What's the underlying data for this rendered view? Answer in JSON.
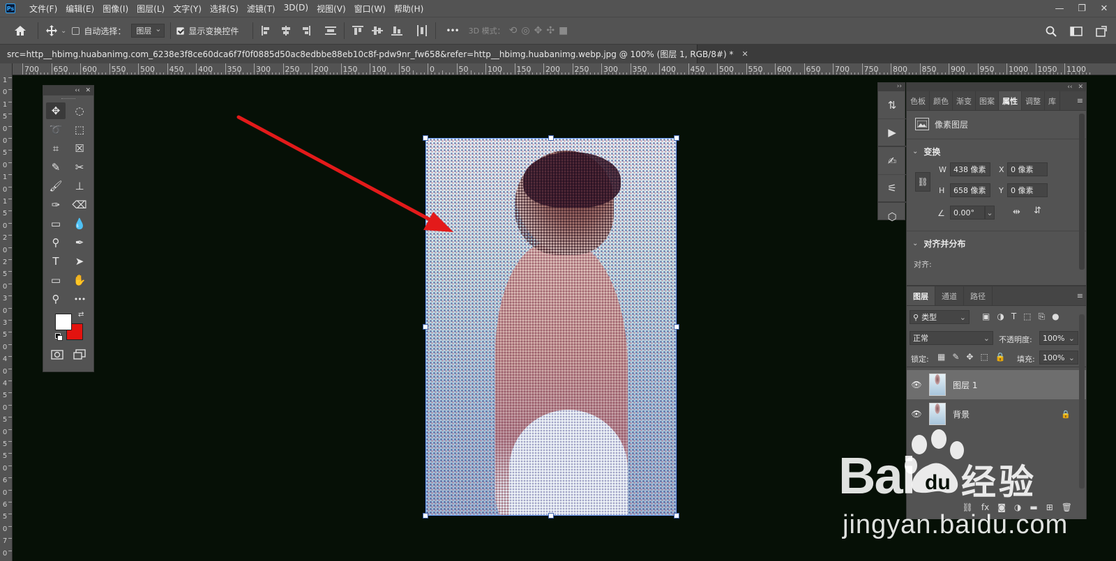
{
  "app": {
    "logo": "Ps"
  },
  "menu": [
    "文件(F)",
    "编辑(E)",
    "图像(I)",
    "图层(L)",
    "文字(Y)",
    "选择(S)",
    "滤镜(T)",
    "3D(D)",
    "视图(V)",
    "窗口(W)",
    "帮助(H)"
  ],
  "window_controls": {
    "minimize": "—",
    "restore": "❐",
    "close": "✕"
  },
  "options_bar": {
    "home_icon": "home-icon",
    "auto_select_label": "自动选择：",
    "auto_select_checked": false,
    "auto_select_target": "图层",
    "show_transform_label": "显示变换控件",
    "show_transform_checked": true,
    "more": "•••",
    "mode3d_label": "3D 模式："
  },
  "document": {
    "tab_title": "src=http__hbimg.huabanimg.com_6238e3f8ce60dca6f7f0f0885d50ac8edbbe88eb10c8f-pdw9nr_fw658&refer=http__hbimg.huabanimg.webp.jpg @ 100% (图层 1, RGB/8#) *",
    "close": "✕"
  },
  "ruler_h": [
    "700",
    "650",
    "600",
    "550",
    "500",
    "450",
    "400",
    "350",
    "300",
    "250",
    "200",
    "150",
    "100",
    "50",
    "0",
    "50",
    "100",
    "150",
    "200",
    "250",
    "300",
    "350",
    "400",
    "450",
    "500",
    "550",
    "600",
    "650",
    "700",
    "750",
    "800",
    "850",
    "900",
    "950",
    "1000",
    "1050",
    "1100"
  ],
  "ruler_v": [
    "1",
    "0",
    "1",
    "5",
    "0",
    "0",
    "5",
    "0",
    "1",
    "0",
    "1",
    "5",
    "0",
    "2",
    "0",
    "2",
    "5",
    "0",
    "3",
    "0",
    "3",
    "5",
    "0",
    "4",
    "0",
    "4",
    "5",
    "0",
    "5",
    "0",
    "5",
    "5",
    "0",
    "6",
    "0",
    "6",
    "5",
    "0",
    "7",
    "0"
  ],
  "tools_panel": {
    "collapse": "‹‹",
    "close": "✕",
    "tools": [
      {
        "name": "move-tool",
        "glyph": "✥",
        "active": true
      },
      {
        "name": "marquee-tool",
        "glyph": "◌"
      },
      {
        "name": "lasso-tool",
        "glyph": "➰"
      },
      {
        "name": "object-select-tool",
        "glyph": "⬚"
      },
      {
        "name": "crop-tool",
        "glyph": "⌗"
      },
      {
        "name": "frame-tool",
        "glyph": "☒"
      },
      {
        "name": "eyedropper-tool",
        "glyph": "✎"
      },
      {
        "name": "healing-tool",
        "glyph": "✂"
      },
      {
        "name": "brush-tool",
        "glyph": "🖌"
      },
      {
        "name": "stamp-tool",
        "glyph": "⊥"
      },
      {
        "name": "history-brush-tool",
        "glyph": "✑"
      },
      {
        "name": "eraser-tool",
        "glyph": "⌫"
      },
      {
        "name": "gradient-tool",
        "glyph": "▭"
      },
      {
        "name": "blur-tool",
        "glyph": "💧"
      },
      {
        "name": "dodge-tool",
        "glyph": "⚲"
      },
      {
        "name": "pen-tool",
        "glyph": "✒"
      },
      {
        "name": "type-tool",
        "glyph": "T"
      },
      {
        "name": "path-select-tool",
        "glyph": "➤"
      },
      {
        "name": "rectangle-tool",
        "glyph": "▭"
      },
      {
        "name": "hand-tool",
        "glyph": "✋"
      },
      {
        "name": "zoom-tool",
        "glyph": "⚲"
      },
      {
        "name": "more-tools",
        "glyph": "•••"
      }
    ],
    "swap": "⇄",
    "foreground_color": "#ffffff",
    "background_color": "#e3130f"
  },
  "properties_panel": {
    "tabs": [
      "色板",
      "颜色",
      "渐变",
      "图案",
      "属性",
      "调整",
      "库"
    ],
    "active_tab": "属性",
    "layer_type": "像素图层",
    "transform_title": "变换",
    "w_label": "W",
    "w_value": "438 像素",
    "h_label": "H",
    "h_value": "658 像素",
    "x_label": "X",
    "x_value": "0 像素",
    "y_label": "Y",
    "y_value": "0 像素",
    "angle_value": "0.00°",
    "align_title": "对齐并分布",
    "align_label": "对齐:"
  },
  "layers_panel": {
    "tabs": [
      "图层",
      "通道",
      "路径"
    ],
    "active_tab": "图层",
    "filter_label": "类型",
    "blend_mode": "正常",
    "opacity_label": "不透明度:",
    "opacity_value": "100%",
    "lock_label": "锁定:",
    "fill_label": "填充:",
    "fill_value": "100%",
    "layers": [
      {
        "name": "图层 1",
        "selected": true,
        "locked": false
      },
      {
        "name": "背景",
        "selected": false,
        "locked": true
      }
    ]
  },
  "watermark": {
    "brand": "Bai",
    "brand2": "经验",
    "url": "jingyan.baidu.com"
  },
  "colors": {
    "ui_dark": "#535353",
    "canvas": "#061006",
    "arrow": "#e31a1a",
    "selection": "#6aa0ff"
  }
}
